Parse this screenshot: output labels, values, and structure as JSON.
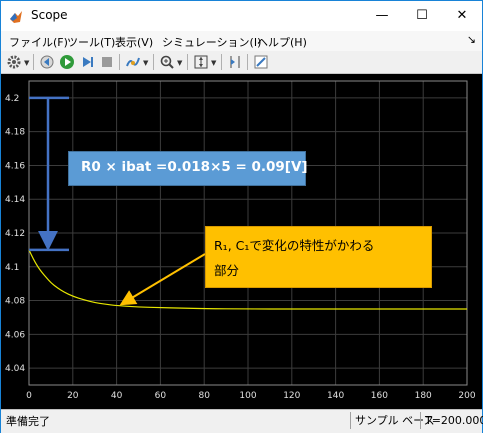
{
  "window": {
    "title": "Scope",
    "minimize_glyph": "—",
    "maximize_glyph": "☐",
    "close_glyph": "✕"
  },
  "menu": {
    "items": [
      {
        "label": "ファイル(F)"
      },
      {
        "label": "ツール(T)"
      },
      {
        "label": "表示(V)"
      },
      {
        "label": "シミュレーション(I)"
      },
      {
        "label": "ヘルプ(H)"
      }
    ],
    "pin_glyph": "↘"
  },
  "toolbar": {
    "icons": [
      "settings-icon",
      "step-back-icon",
      "run-icon",
      "step-forward-icon",
      "stop-icon",
      "highlight-icon",
      "zoom-icon",
      "autoscale-icon",
      "cursor-measure-icon",
      "edit-icon"
    ]
  },
  "colors": {
    "trace": "#e6e600",
    "grid": "#3c3c3c",
    "axis_text": "#e0e0e0",
    "callout_blue": "#5b9bd5",
    "callout_orange": "#ffc000",
    "arrow_blue": "#4472c4"
  },
  "chart_data": {
    "type": "line",
    "xlim": [
      0,
      200
    ],
    "ylim": [
      4.03,
      4.21
    ],
    "x_ticks": [
      0,
      20,
      40,
      60,
      80,
      100,
      120,
      140,
      160,
      180,
      200
    ],
    "y_ticks": [
      4.04,
      4.06,
      4.08,
      4.1,
      4.12,
      4.14,
      4.16,
      4.18,
      4.2
    ],
    "grid": true,
    "x": [
      0,
      2,
      4,
      6,
      8,
      10,
      13,
      16,
      20,
      25,
      30,
      35,
      40,
      50,
      60,
      70,
      80,
      100,
      120,
      140,
      160,
      180,
      200
    ],
    "y": [
      4.11,
      4.1045,
      4.1,
      4.0965,
      4.0935,
      4.0905,
      4.0875,
      4.085,
      4.0825,
      4.0805,
      4.0788,
      4.0778,
      4.077,
      4.0762,
      4.0758,
      4.0755,
      4.0752,
      4.075,
      4.075,
      4.075,
      4.075,
      4.075,
      4.075
    ]
  },
  "annotations": {
    "drop_label": "R0 × ibat =0.018×5 = 0.09[V]",
    "rc_label_line1": "R₁, C₁で変化の特性がかわる",
    "rc_label_line2": "部分",
    "vertical_span": {
      "from": 4.2,
      "to": 4.11
    }
  },
  "status": {
    "left": "準備完了",
    "mode": "サンプル ベース",
    "time": "T=200.000"
  }
}
